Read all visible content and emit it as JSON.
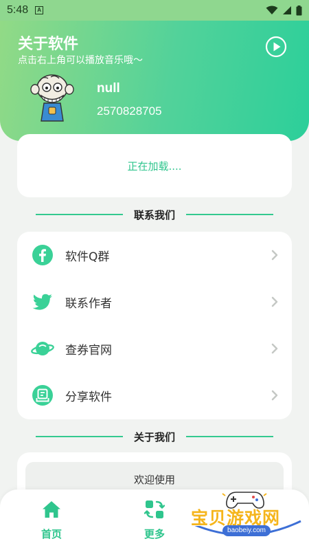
{
  "status_bar": {
    "time": "5:48",
    "notification_glyph": "A"
  },
  "header": {
    "title": "关于软件",
    "subtitle": "点击右上角可以播放音乐哦～",
    "user_name": "null",
    "user_id": "2570828705"
  },
  "loading": {
    "text": "正在加载...."
  },
  "contact_section": {
    "title": "联系我们",
    "items": [
      {
        "label": "软件Q群",
        "icon": "facebook-icon"
      },
      {
        "label": "联系作者",
        "icon": "twitter-icon"
      },
      {
        "label": "查券官网",
        "icon": "planet-icon"
      },
      {
        "label": "分享软件",
        "icon": "share-icon"
      }
    ]
  },
  "about_section": {
    "title": "关于我们",
    "welcome": "欢迎使用"
  },
  "bottom_nav": {
    "items": [
      {
        "label": "首页",
        "icon": "home-icon"
      },
      {
        "label": "更多",
        "icon": "more-icon"
      }
    ]
  },
  "watermark": {
    "text": "宝贝游戏网",
    "url": "baobeiy.com"
  },
  "colors": {
    "accent": "#2fc58d",
    "header_start": "#92da86",
    "header_end": "#2ccf9a"
  }
}
